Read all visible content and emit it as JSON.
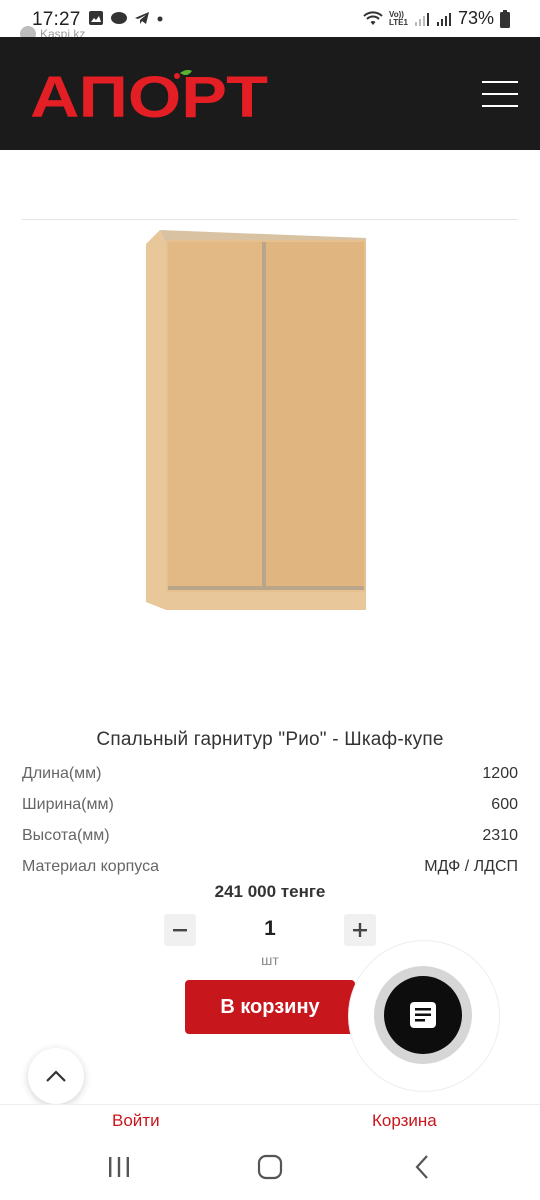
{
  "status_bar": {
    "time": "17:27",
    "battery": "73%",
    "lte_label_top": "Vo))",
    "lte_label_bottom": "LTE1",
    "kaspi_label": "Kaspi.kz"
  },
  "header": {
    "logo_text": "АПОРТ",
    "menu_icon": "hamburger-icon"
  },
  "product": {
    "title": "Спальный гарнитур \"Рио\" - Шкаф-купе",
    "specs": [
      {
        "label": "Длина(мм)",
        "value": "1200"
      },
      {
        "label": "Ширина(мм)",
        "value": "600"
      },
      {
        "label": "Высота(мм)",
        "value": "2310"
      },
      {
        "label": "Материал корпуса",
        "value": "МДФ / ЛДСП"
      }
    ],
    "price": "241 000 тенге",
    "quantity": "1",
    "unit": "шт",
    "add_to_cart": "В корзину"
  },
  "bottom_bar": {
    "login": "Войти",
    "cart": "Корзина"
  },
  "colors": {
    "brand_red": "#c8161d",
    "header_bg": "#1b1b1b",
    "wood": "#e2b885"
  }
}
